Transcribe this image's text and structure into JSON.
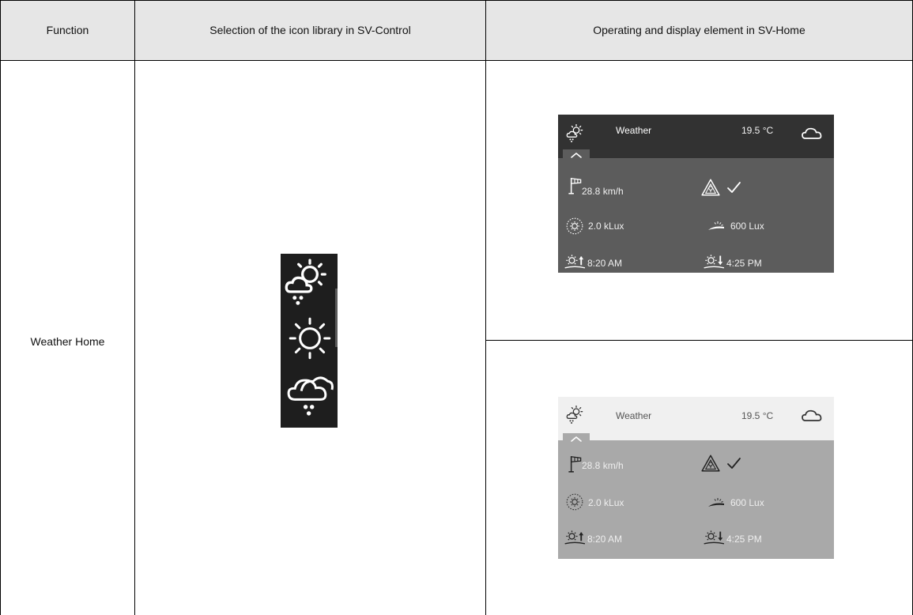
{
  "table": {
    "headers": {
      "function": "Function",
      "library": "Selection of the icon library in SV-Control",
      "element": "Operating and display element in SV-Home"
    },
    "row": {
      "function": "Weather Home"
    }
  },
  "icon_library": {
    "icons": [
      "weather-sun-cloud-rain-icon",
      "weather-sun-icon",
      "weather-cloud-rain-icon"
    ],
    "background_color": "#1e1e1e"
  },
  "widgets": {
    "dark": {
      "title": "Weather",
      "temperature": "19.5 °C",
      "wind_speed": "28.8 km/h",
      "brightness": "2.0 kLux",
      "twilight": "600 Lux",
      "sunrise": "8:20 AM",
      "sunset": "4:25 PM",
      "header_color": "#323232",
      "body_color": "#5c5c5c"
    },
    "light": {
      "title": "Weather",
      "temperature": "19.5 °C",
      "wind_speed": "28.8 km/h",
      "brightness": "2.0 kLux",
      "twilight": "600 Lux",
      "sunrise": "8:20 AM",
      "sunset": "4:25 PM",
      "header_color": "#f0f0f0",
      "body_color": "#a9a9a9"
    }
  }
}
